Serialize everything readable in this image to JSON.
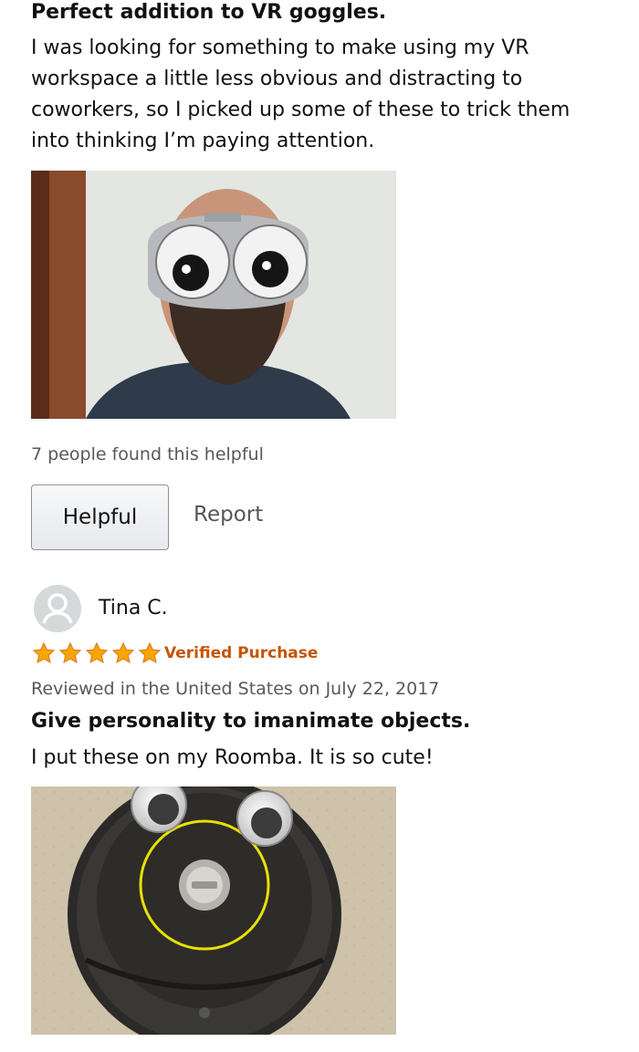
{
  "review1": {
    "title": "Perfect addition to VR goggles.",
    "body_lines": [
      "I was looking for something to make using my VR",
      "workspace a little less obvious and distracting to",
      "coworkers, so I picked up some of these to trick them",
      "into thinking I’m paying attention."
    ],
    "helpful_count": "7 people found this helpful",
    "helpful_label": "Helpful",
    "report_label": "Report"
  },
  "review2": {
    "reviewer_name": "Tina C.",
    "rating": 5,
    "verified_label": "Verified Purchase",
    "meta": "Reviewed in the United States on July 22, 2017",
    "title": "Give personality to imanimate objects.",
    "body": "I put these on my Roomba. It is so cute!"
  },
  "colors": {
    "star": "#f7a600",
    "verified": "#c45500",
    "muted_text": "#565959"
  },
  "icons": {
    "star": "star-icon",
    "avatar": "default-user-avatar-icon"
  }
}
